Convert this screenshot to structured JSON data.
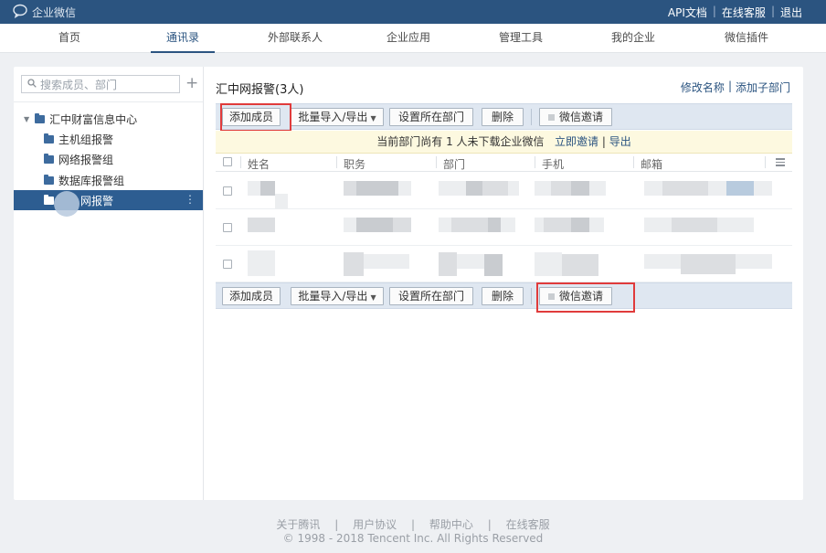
{
  "topbar": {
    "logo_text": "企业微信",
    "links": [
      "API文档",
      "在线客服",
      "退出"
    ],
    "separator": "|"
  },
  "nav": {
    "items": [
      "首页",
      "通讯录",
      "外部联系人",
      "企业应用",
      "管理工具",
      "我的企业",
      "微信插件"
    ],
    "active": "通讯录"
  },
  "sidebar": {
    "search_placeholder": "搜索成员、部门",
    "add_symbol": "+",
    "root": "汇中财富信息中心",
    "groups": [
      "主机组报警",
      "网络报警组",
      "数据库报警组",
      "网报警"
    ],
    "selected": "网报警",
    "more_symbol": "⋮"
  },
  "content": {
    "dept_title": "汇中网报警(3人)",
    "rename_link": "修改名称",
    "link_separator": "|",
    "add_sub_dept_link": "添加子部门",
    "toolbar": {
      "add_member": "添加成员",
      "batch_import_export": "批量导入/导出",
      "dropdown_arrow": "▼",
      "set_department": "设置所在部门",
      "delete": "删除",
      "wechat_invite": "微信邀请"
    },
    "notice": {
      "text": "当前部门尚有 1 人未下载企业微信",
      "invite_link": "立即邀请",
      "separator": "|",
      "export_link": "导出"
    },
    "table": {
      "columns": [
        "姓名",
        "职务",
        "部门",
        "手机",
        "邮箱"
      ],
      "row_count": 3
    }
  },
  "footer": {
    "links": [
      "关于腾讯",
      "用户协议",
      "帮助中心",
      "在线客服"
    ],
    "separator": "|",
    "copyright": "© 1998 - 2018 Tencent Inc. All Rights Reserved"
  },
  "colors": {
    "brand": "#2b5480",
    "highlight_box": "#e03b3b",
    "notice_bg": "#fdf9e0",
    "toolbar_bg": "#dfe7f1"
  }
}
